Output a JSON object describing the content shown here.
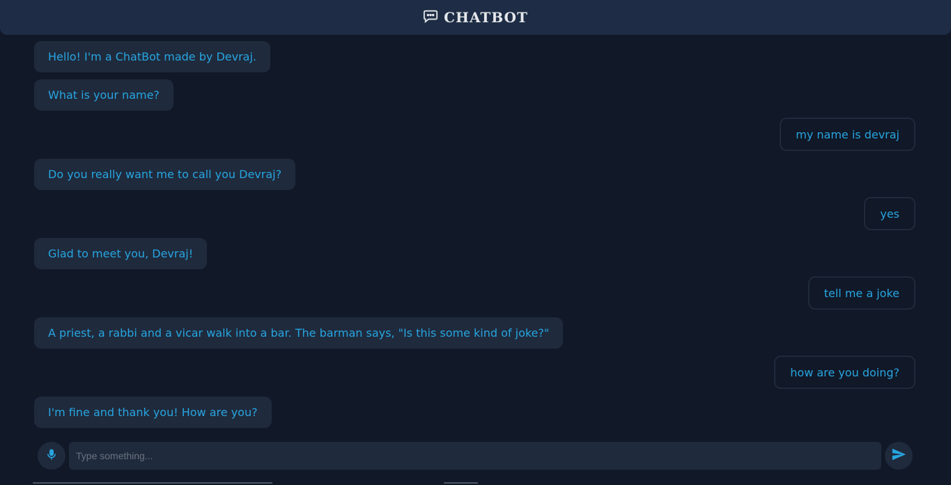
{
  "header": {
    "title": "CHATBOT",
    "icon": "chat-bubble-icon"
  },
  "messages": [
    {
      "role": "bot",
      "text": "Hello! I'm a ChatBot made by Devraj."
    },
    {
      "role": "bot",
      "text": "What is your name?"
    },
    {
      "role": "user",
      "text": "my name is devraj"
    },
    {
      "role": "bot",
      "text": "Do you really want me to call you Devraj?"
    },
    {
      "role": "user",
      "text": "yes"
    },
    {
      "role": "bot",
      "text": "Glad to meet you, Devraj!"
    },
    {
      "role": "user",
      "text": "tell me a joke"
    },
    {
      "role": "bot",
      "text": "A priest, a rabbi and a vicar walk into a bar. The barman says, \"Is this some kind of joke?\""
    },
    {
      "role": "user",
      "text": "how are you doing?"
    },
    {
      "role": "bot",
      "text": "I'm fine and thank you! How are you?"
    }
  ],
  "composer": {
    "placeholder": "Type something...",
    "value": "",
    "mic_icon": "microphone-icon",
    "send_icon": "send-icon"
  },
  "colors": {
    "background": "#111827",
    "header": "#1e2d45",
    "bubble": "#1f2a3c",
    "text_accent": "#27a5e0"
  }
}
